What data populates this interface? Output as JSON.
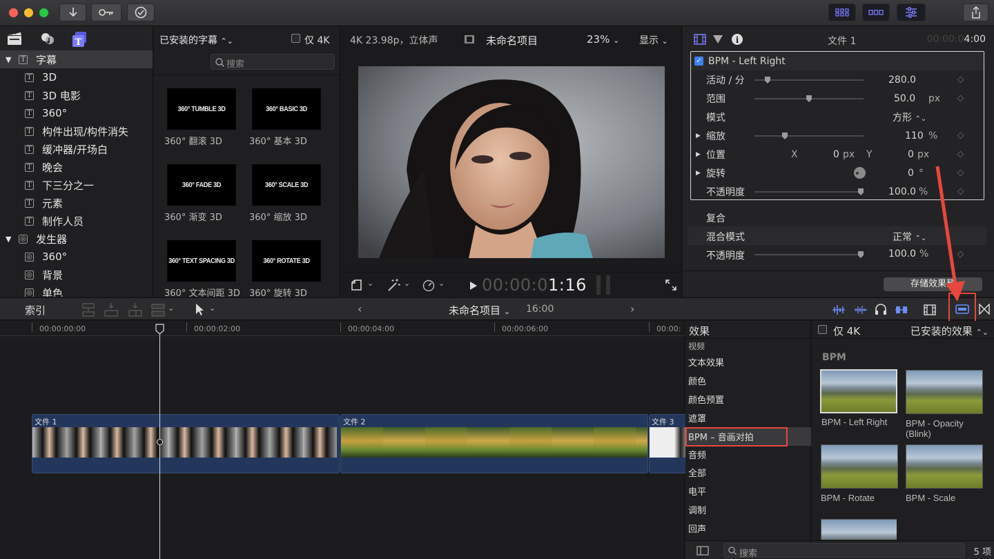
{
  "library_panel": {
    "items": [
      {
        "label": "字幕",
        "level": 0,
        "expanded": true,
        "selected": true,
        "icon": "title-icon"
      },
      {
        "label": "3D",
        "level": 1,
        "icon": "title-icon"
      },
      {
        "label": "3D 电影",
        "level": 1,
        "icon": "title-icon"
      },
      {
        "label": "360°",
        "level": 1,
        "icon": "title-icon"
      },
      {
        "label": "构件出现/构件消失",
        "level": 1,
        "icon": "title-icon"
      },
      {
        "label": "缓冲器/开场白",
        "level": 1,
        "icon": "title-icon"
      },
      {
        "label": "晚会",
        "level": 1,
        "icon": "title-icon"
      },
      {
        "label": "下三分之一",
        "level": 1,
        "icon": "title-icon"
      },
      {
        "label": "元素",
        "level": 1,
        "icon": "title-icon"
      },
      {
        "label": "制作人员",
        "level": 1,
        "icon": "title-icon"
      },
      {
        "label": "发生器",
        "level": 0,
        "expanded": true,
        "icon": "generator-icon"
      },
      {
        "label": "360°",
        "level": 1,
        "icon": "generator-icon"
      },
      {
        "label": "背景",
        "level": 1,
        "icon": "generator-icon"
      },
      {
        "label": "单色",
        "level": 1,
        "icon": "generator-icon"
      }
    ]
  },
  "title_browser": {
    "dropdown": "已安装的字幕",
    "only4k_label": "仅 4K",
    "search_placeholder": "搜索",
    "thumbs": [
      {
        "thumb": "360° TUMBLE 3D",
        "label": "360° 翻滚 3D"
      },
      {
        "thumb": "360° BASIC 3D",
        "label": "360° 基本 3D"
      },
      {
        "thumb": "360° FADE 3D",
        "label": "360° 渐变 3D"
      },
      {
        "thumb": "360° SCALE 3D",
        "label": "360° 缩放 3D"
      },
      {
        "thumb": "360° TEXT SPACING 3D",
        "label": "360° 文本间距 3D"
      },
      {
        "thumb": "360° ROTATE 3D",
        "label": "360° 旋转 3D"
      }
    ]
  },
  "viewer": {
    "format": "4K 23.98p，立体声",
    "project": "未命名项目",
    "zoom": "23%",
    "display": "显示",
    "timecode_dim": "00:00:0",
    "timecode_bright": "1:16"
  },
  "inspector": {
    "title": "文件 1",
    "duration_dim": "00:00:0",
    "duration_bright": "4:00",
    "effect_name": "BPM - Left Right",
    "params": [
      {
        "label": "活动 / 分",
        "value": "280.0",
        "unit": "",
        "slider": 0.12
      },
      {
        "label": "范围",
        "value": "50.0",
        "unit": "px",
        "slider": 0.5
      },
      {
        "label": "模式",
        "value": "方形",
        "unit": "⌃⌄"
      },
      {
        "label": "缩放",
        "value": "110",
        "unit": "%",
        "slider": 0.28,
        "disclosure": true
      },
      {
        "label": "位置",
        "x_label": "X",
        "x_value": "0",
        "x_unit": "px",
        "y_label": "Y",
        "y_value": "0",
        "y_unit": "px",
        "disclosure": true
      },
      {
        "label": "旋转",
        "value": "0",
        "unit": "°",
        "disclosure": true
      },
      {
        "label": "不透明度",
        "value": "100.0",
        "unit": "%",
        "slider": 1.0
      }
    ],
    "composite_label": "复合",
    "blend_label": "混合模式",
    "blend_value": "正常",
    "opacity_label": "不透明度",
    "opacity_value": "100.0",
    "opacity_unit": "%",
    "save_preset": "存储效果预"
  },
  "timeline_bar": {
    "index": "索引",
    "project": "未命名项目",
    "duration": "16:00"
  },
  "timeline": {
    "ruler": [
      "00:00:00:00",
      "00:00:02:00",
      "00:00:04:00",
      "00:00:06:00",
      "00:00:"
    ],
    "clips": [
      {
        "name": "文件 1"
      },
      {
        "name": "文件 2"
      },
      {
        "name": "文件 3"
      }
    ]
  },
  "effects": {
    "header": "效果",
    "categories": [
      {
        "label": "视频",
        "section": true
      },
      {
        "label": "文本效果"
      },
      {
        "label": "颜色"
      },
      {
        "label": "颜色预置"
      },
      {
        "label": "遮罩"
      },
      {
        "label": "BPM – 音画对拍",
        "selected": true
      },
      {
        "label": "音频",
        "section": true
      },
      {
        "label": "全部"
      },
      {
        "label": "电平"
      },
      {
        "label": "调制"
      },
      {
        "label": "回声"
      }
    ],
    "only4k_label": "仅 4K",
    "dropdown": "已安装的效果",
    "group": "BPM",
    "items": [
      {
        "label": "BPM - Left Right"
      },
      {
        "label": "BPM - Opacity\n(Blink)"
      },
      {
        "label": "BPM - Rotate"
      },
      {
        "label": "BPM - Scale"
      }
    ],
    "search_placeholder": "搜索",
    "count": "5 项"
  },
  "colors": {
    "accent": "#3b82f6",
    "highlight": "#e8473c",
    "clip": "#23375c",
    "icon_blue": "#7b7bff"
  }
}
